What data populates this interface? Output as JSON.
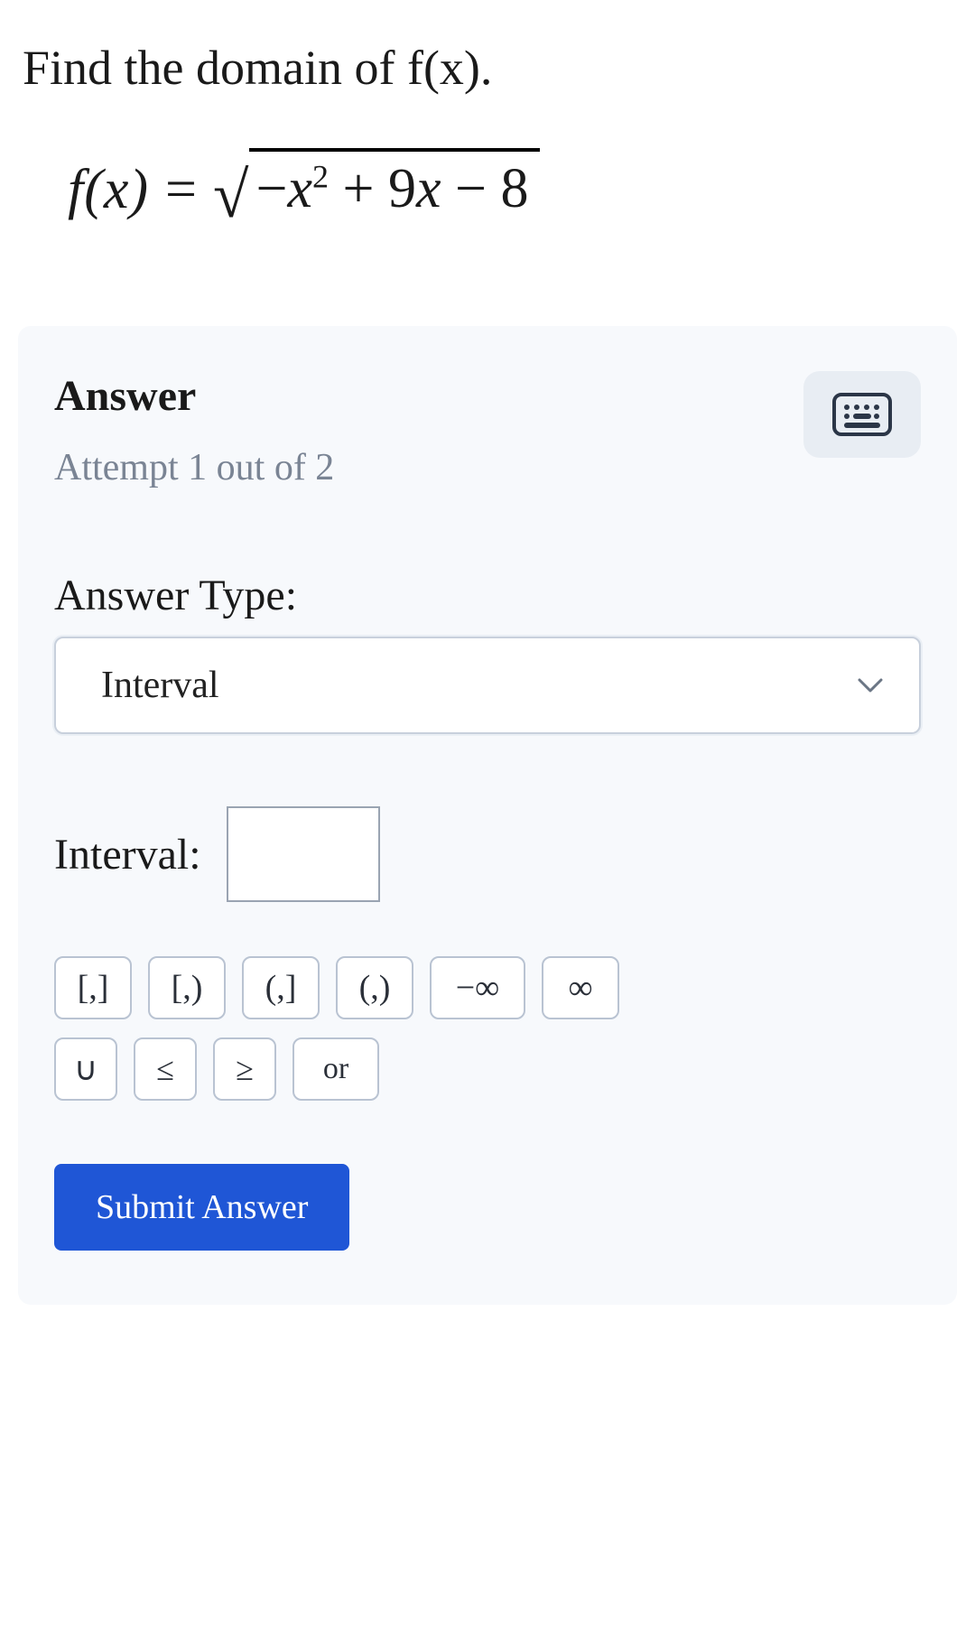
{
  "question": {
    "prompt": "Find the domain of f(x).",
    "equation": {
      "lhs": "f(x)",
      "equals": "=",
      "radical": "√",
      "radicand_parts": {
        "minus1": "−",
        "x": "x",
        "sq": "2",
        "plus": " + 9",
        "x2": "x",
        "tail": " − 8"
      }
    }
  },
  "answer": {
    "title": "Answer",
    "attempt": "Attempt 1 out of 2",
    "keyboard_icon": "keyboard-icon",
    "type_label": "Answer Type:",
    "type_value": "Interval",
    "interval_label": "Interval:",
    "interval_value": ""
  },
  "buttons": {
    "closed_closed": "[,]",
    "closed_open": "[,)",
    "open_closed": "(,]",
    "open_open": "(,)",
    "neg_inf": "−∞",
    "pos_inf": "∞",
    "union": "∪",
    "lte": "≤",
    "gte": "≥",
    "or": "or"
  },
  "submit": {
    "label": "Submit Answer"
  }
}
